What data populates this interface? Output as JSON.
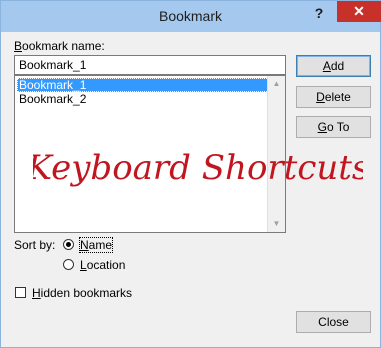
{
  "window": {
    "title": "Bookmark",
    "help_label": "?",
    "close_label": "✕"
  },
  "bookmark_name": {
    "label": "Bookmark name:",
    "value": "Bookmark_1"
  },
  "bookmarks": {
    "items": [
      {
        "label": "Bookmark_1",
        "selected": true
      },
      {
        "label": "Bookmark_2",
        "selected": false
      }
    ]
  },
  "buttons": {
    "add": "Add",
    "delete": "Delete",
    "goto": "Go To",
    "close": "Close"
  },
  "sort_by": {
    "label": "Sort by:",
    "options": [
      {
        "label": "Name",
        "checked": true
      },
      {
        "label": "Location",
        "checked": false
      }
    ]
  },
  "hidden_bookmarks": {
    "label": "Hidden bookmarks",
    "checked": false
  },
  "watermark": {
    "text": "Keyboard Shortcuts",
    "color": "#c0161f"
  },
  "colors": {
    "titlebar": "#a5c8ee",
    "close_button": "#c7312a",
    "selection": "#3399ff"
  }
}
